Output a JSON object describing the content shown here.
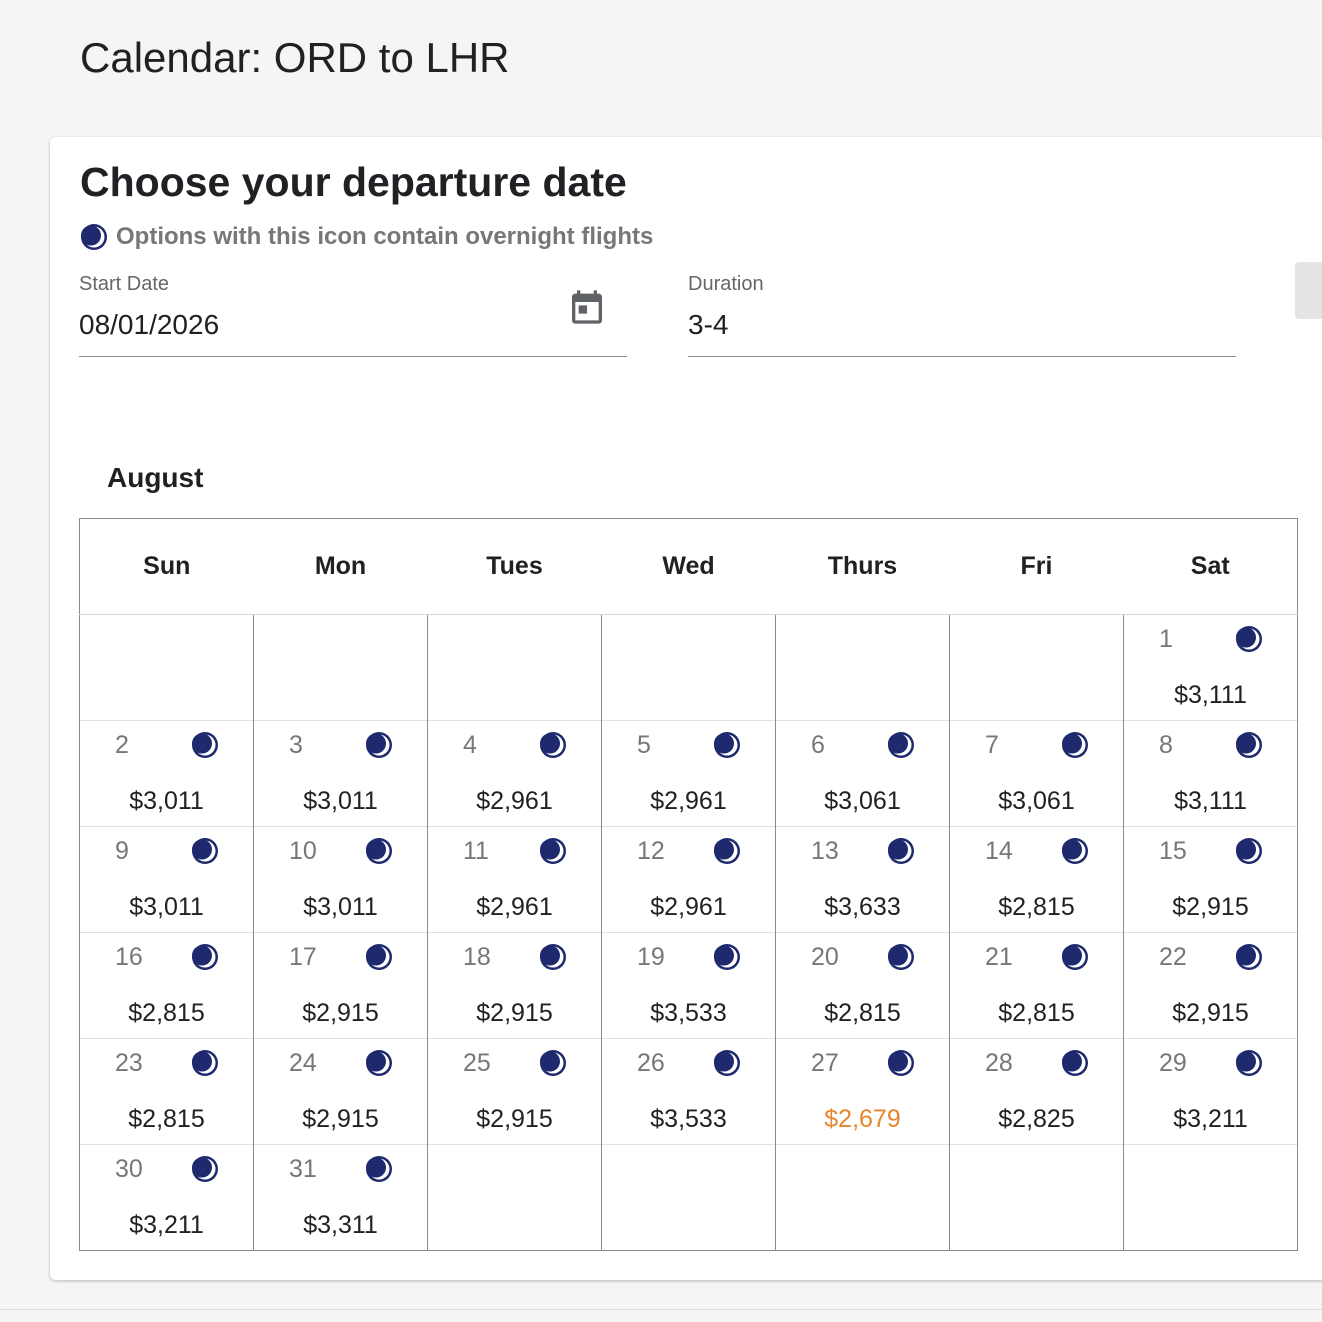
{
  "page": {
    "title": "Calendar: ORD to LHR"
  },
  "card": {
    "heading": "Choose your departure date",
    "legend_icon": "moon-icon",
    "legend_text": "Options with this icon contain overnight flights"
  },
  "form": {
    "start_date": {
      "label": "Start Date",
      "value": "08/01/2026",
      "icon": "calendar-icon"
    },
    "duration": {
      "label": "Duration",
      "value": "3-4"
    }
  },
  "calendar": {
    "month": "August",
    "weekdays": [
      "Sun",
      "Mon",
      "Tues",
      "Wed",
      "Thurs",
      "Fri",
      "Sat"
    ],
    "colors": {
      "moon": "#1f2a6e",
      "best_price": "#e8852b"
    },
    "weeks": [
      [
        null,
        null,
        null,
        null,
        null,
        null,
        {
          "day": "1",
          "price": "$3,111",
          "overnight": true
        }
      ],
      [
        {
          "day": "2",
          "price": "$3,011",
          "overnight": true
        },
        {
          "day": "3",
          "price": "$3,011",
          "overnight": true
        },
        {
          "day": "4",
          "price": "$2,961",
          "overnight": true
        },
        {
          "day": "5",
          "price": "$2,961",
          "overnight": true
        },
        {
          "day": "6",
          "price": "$3,061",
          "overnight": true
        },
        {
          "day": "7",
          "price": "$3,061",
          "overnight": true
        },
        {
          "day": "8",
          "price": "$3,111",
          "overnight": true
        }
      ],
      [
        {
          "day": "9",
          "price": "$3,011",
          "overnight": true
        },
        {
          "day": "10",
          "price": "$3,011",
          "overnight": true
        },
        {
          "day": "11",
          "price": "$2,961",
          "overnight": true
        },
        {
          "day": "12",
          "price": "$2,961",
          "overnight": true
        },
        {
          "day": "13",
          "price": "$3,633",
          "overnight": true
        },
        {
          "day": "14",
          "price": "$2,815",
          "overnight": true
        },
        {
          "day": "15",
          "price": "$2,915",
          "overnight": true
        }
      ],
      [
        {
          "day": "16",
          "price": "$2,815",
          "overnight": true
        },
        {
          "day": "17",
          "price": "$2,915",
          "overnight": true
        },
        {
          "day": "18",
          "price": "$2,915",
          "overnight": true
        },
        {
          "day": "19",
          "price": "$3,533",
          "overnight": true
        },
        {
          "day": "20",
          "price": "$2,815",
          "overnight": true
        },
        {
          "day": "21",
          "price": "$2,815",
          "overnight": true
        },
        {
          "day": "22",
          "price": "$2,915",
          "overnight": true
        }
      ],
      [
        {
          "day": "23",
          "price": "$2,815",
          "overnight": true
        },
        {
          "day": "24",
          "price": "$2,915",
          "overnight": true
        },
        {
          "day": "25",
          "price": "$2,915",
          "overnight": true
        },
        {
          "day": "26",
          "price": "$3,533",
          "overnight": true
        },
        {
          "day": "27",
          "price": "$2,679",
          "overnight": true,
          "best": true
        },
        {
          "day": "28",
          "price": "$2,825",
          "overnight": true
        },
        {
          "day": "29",
          "price": "$3,211",
          "overnight": true
        }
      ],
      [
        {
          "day": "30",
          "price": "$3,211",
          "overnight": true
        },
        {
          "day": "31",
          "price": "$3,311",
          "overnight": true
        },
        null,
        null,
        null,
        null,
        null
      ]
    ]
  }
}
